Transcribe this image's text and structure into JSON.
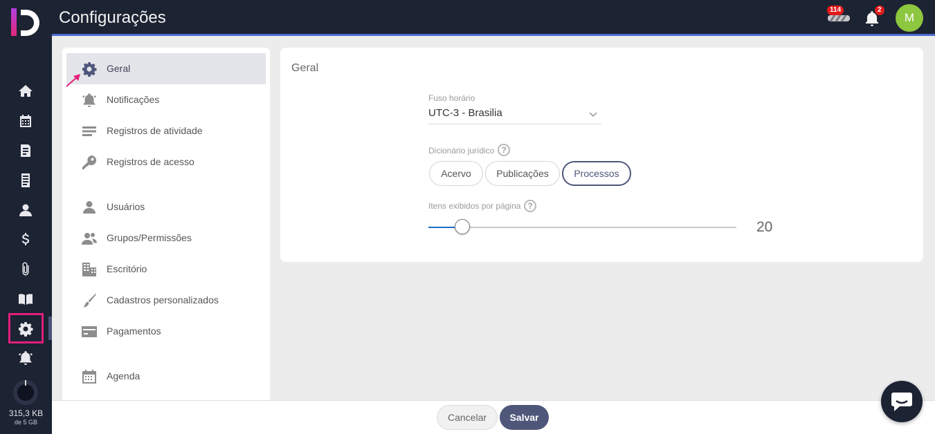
{
  "header": {
    "title": "Configurações",
    "credits_badge": "114",
    "notifications_badge": "2",
    "avatar_initial": "M"
  },
  "rail": {
    "items": [
      {
        "icon": "home-icon"
      },
      {
        "icon": "calendar-icon"
      },
      {
        "icon": "document-icon"
      },
      {
        "icon": "list-document-icon"
      },
      {
        "icon": "person-icon"
      },
      {
        "icon": "dollar-icon"
      },
      {
        "icon": "paperclip-icon"
      },
      {
        "icon": "book-icon"
      },
      {
        "icon": "gear-icon",
        "active": true
      },
      {
        "icon": "bell-icon"
      }
    ],
    "storage_used": "315,3 KB",
    "storage_total": "de 5 GB"
  },
  "settings_menu": {
    "items": [
      {
        "label": "Geral",
        "icon": "gear-icon",
        "active": true
      },
      {
        "label": "Notificações",
        "icon": "bell-icon"
      },
      {
        "label": "Registros de atividade",
        "icon": "list-icon"
      },
      {
        "label": "Registros de acesso",
        "icon": "key-icon"
      },
      {
        "label": "Usuários",
        "icon": "user-icon"
      },
      {
        "label": "Grupos/Permissões",
        "icon": "group-icon"
      },
      {
        "label": "Escritório",
        "icon": "building-icon"
      },
      {
        "label": "Cadastros personalizados",
        "icon": "brush-icon"
      },
      {
        "label": "Pagamentos",
        "icon": "credit-card-icon"
      },
      {
        "label": "Agenda",
        "icon": "calendar-icon"
      }
    ]
  },
  "general": {
    "title": "Geral",
    "timezone_label": "Fuso horário",
    "timezone_value": "UTC-3 - Brasilia",
    "dictionary_label": "Dicionário jurídico",
    "dictionary_options": [
      "Acervo",
      "Publicações",
      "Processos"
    ],
    "dictionary_selected": "Processos",
    "items_label": "Itens exibidos por página",
    "items_value": "20",
    "items_slider_fraction": 0.11
  },
  "footer": {
    "cancel_label": "Cancelar",
    "save_label": "Salvar"
  },
  "colors": {
    "dark_nav": "#1c2333",
    "accent": "#4e567a",
    "highlight": "#e21f7a",
    "avatar": "#8dc63f",
    "badge": "#e11b1b"
  }
}
